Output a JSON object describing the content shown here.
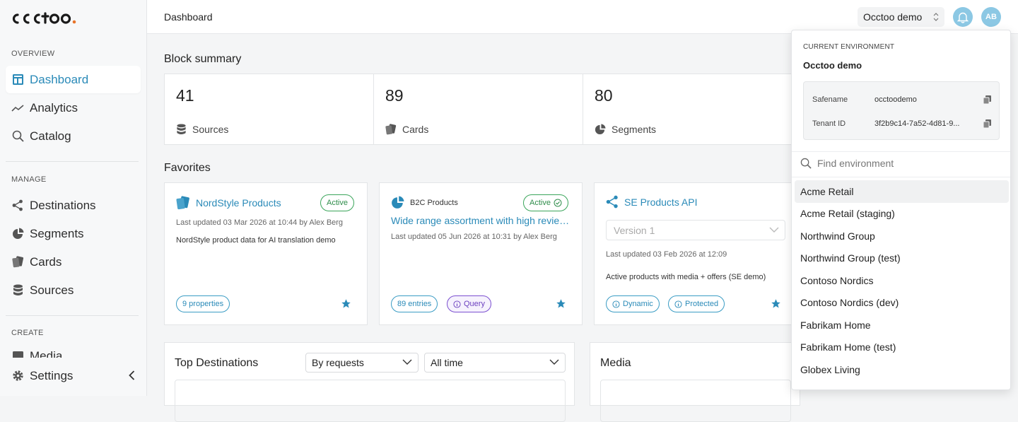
{
  "app": {
    "logo_text": "occtoo"
  },
  "sidebar": {
    "sections": {
      "overview": "OVERVIEW",
      "manage": "MANAGE",
      "create": "CREATE"
    },
    "items": {
      "dashboard": "Dashboard",
      "analytics": "Analytics",
      "catalog": "Catalog",
      "destinations": "Destinations",
      "segments": "Segments",
      "cards": "Cards",
      "sources": "Sources",
      "media": "Media",
      "settings": "Settings"
    }
  },
  "header": {
    "breadcrumb": "Dashboard",
    "environment": "Occtoo demo",
    "avatar_initials": "AB"
  },
  "block_summary": {
    "title": "Block summary",
    "items": [
      {
        "value": "41",
        "label": "Sources"
      },
      {
        "value": "89",
        "label": "Cards"
      },
      {
        "value": "80",
        "label": "Segments"
      }
    ]
  },
  "favorites": {
    "title": "Favorites",
    "cards": [
      {
        "title": "NordStyle Products",
        "status": "Active",
        "meta": "Last updated 03 Mar 2026 at 10:44 by Alex Berg",
        "description": "NordStyle product data for AI translation demo",
        "pill1": "9 properties"
      },
      {
        "title": "B2C Products",
        "subtitle": "Wide range assortment with high reviews",
        "status": "Active",
        "meta": "Last updated 05 Jun 2026 at 10:31 by Alex Berg",
        "pill1": "89 entries",
        "pill2": "Query"
      },
      {
        "title": "SE Products API",
        "version": "Version 1",
        "meta": "Last updated 03 Feb 2026 at 12:09",
        "description": "Active products with media + offers (SE demo)",
        "pill1": "Dynamic",
        "pill2": "Protected"
      }
    ]
  },
  "top_destinations": {
    "title": "Top Destinations",
    "sort": "By requests",
    "range": "All time"
  },
  "media": {
    "title": "Media"
  },
  "env_dropdown": {
    "caption": "CURRENT ENVIRONMENT",
    "current": "Occtoo demo",
    "safename_label": "Safename",
    "safename": "occtoodemo",
    "tenant_label": "Tenant ID",
    "tenant": "3f2b9c14-7a52-4d81-9...",
    "search_placeholder": "Find environment",
    "environments": [
      "Acme Retail",
      "Acme Retail (staging)",
      "Northwind Group",
      "Northwind Group (test)",
      "Contoso Nordics",
      "Contoso Nordics (dev)",
      "Fabrikam Home",
      "Fabrikam Home (test)",
      "Globex Living"
    ]
  },
  "colors": {
    "accent": "#2a8ab8",
    "active_green": "#2f8d4b",
    "query_purple": "#6b3fbf"
  }
}
